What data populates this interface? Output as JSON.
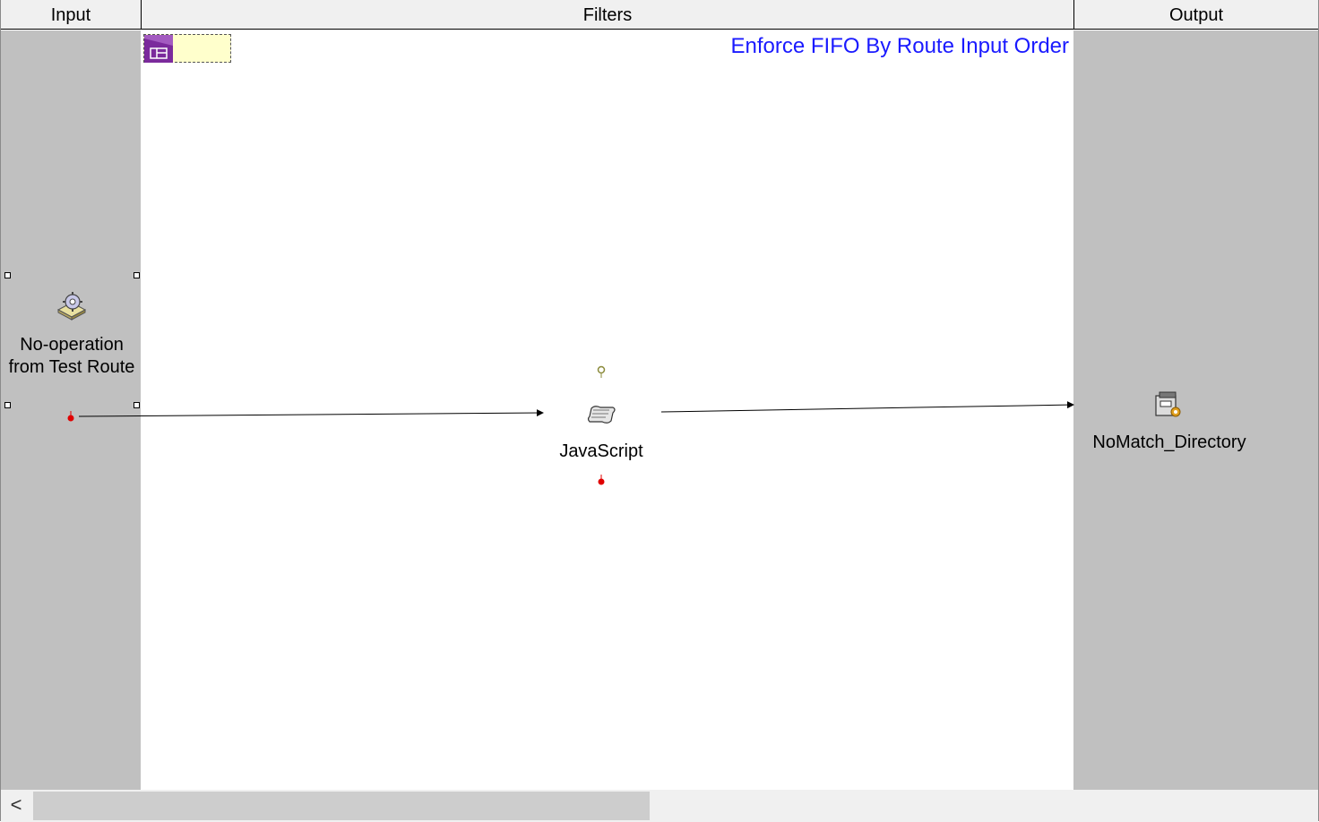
{
  "columns": {
    "input_label": "Input",
    "filters_label": "Filters",
    "output_label": "Output"
  },
  "diagram": {
    "title": "Enforce FIFO By Route Input Order",
    "input_node": {
      "label": "No-operation from Test Route",
      "icon": "gear-disk-icon"
    },
    "filter_node": {
      "label": "JavaScript",
      "icon": "scroll-icon"
    },
    "output_node": {
      "label": "NoMatch_Directory",
      "icon": "disk-drive-icon"
    }
  },
  "colors": {
    "title": "#1a1aff",
    "lane_gray": "#c0c0c0",
    "note": "#ffffcc",
    "note_tab": "#7b2a9c",
    "error_port": "#e00000",
    "success_port": "#8a8a3a"
  },
  "scrollbar": {
    "left_arrow": "<"
  }
}
